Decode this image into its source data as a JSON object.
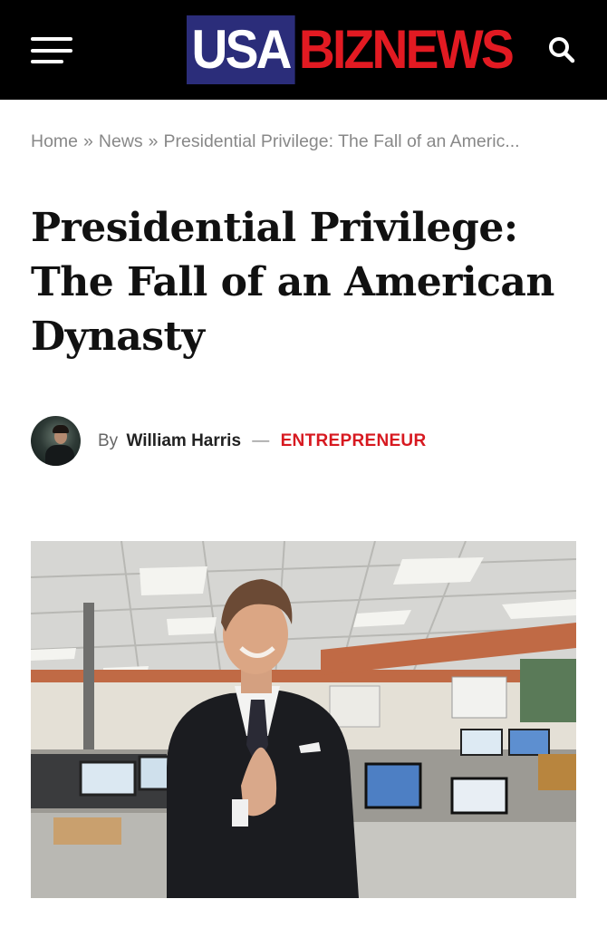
{
  "header": {
    "logo_part1": "USA",
    "logo_part2": "BIZNEWS",
    "menu_icon": "hamburger-menu-icon",
    "search_icon": "search-icon",
    "background": "#000000",
    "logo_blue": "#2b2d7a",
    "logo_red": "#e21a22"
  },
  "breadcrumb": {
    "home": "Home",
    "separator": "»",
    "news": "News",
    "current": "Presidential Privilege: The Fall of an Americ..."
  },
  "article": {
    "title": "Presidential Privilege: The Fall of an American Dynasty",
    "by_label": "By",
    "author": "William Harris",
    "byline_dash": "—",
    "category": "ENTREPRENEUR",
    "category_color": "#d71920"
  }
}
